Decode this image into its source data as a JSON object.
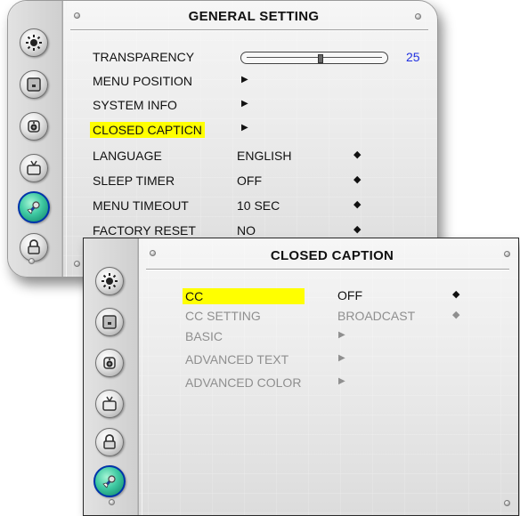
{
  "general_setting": {
    "title": "GENERAL SETTING",
    "transparency": {
      "label": "TRANSPARENCY",
      "value": "25",
      "level": 0.55
    },
    "items": [
      {
        "label": "MENU POSITION"
      },
      {
        "label": "SYSTEM INFO"
      },
      {
        "label": "CLOSED CAPTICN"
      }
    ],
    "settings": [
      {
        "label": "LANGUAGE",
        "value": "ENGLISH"
      },
      {
        "label": "SLEEP TIMER",
        "value": "OFF"
      },
      {
        "label": "MENU TIMEOUT",
        "value": "10 SEC"
      },
      {
        "label": "FACTORY RESET",
        "value": "NO"
      }
    ],
    "sidebar_icons": [
      "brightness-icon",
      "picture-icon",
      "audio-icon",
      "tv-icon",
      "settings-wrench-icon",
      "lock-icon"
    ]
  },
  "closed_caption": {
    "title": "CLOSED CAPTION",
    "cc": {
      "label": "CC",
      "value": "OFF"
    },
    "cc_setting": {
      "label": "CC SETTING",
      "value": "BROADCAST"
    },
    "submenus": [
      {
        "label": "BASIC"
      },
      {
        "label": "ADVANCED TEXT"
      },
      {
        "label": "ADVANCED COLOR"
      }
    ],
    "sidebar_icons": [
      "brightness-icon",
      "picture-icon",
      "audio-icon",
      "tv-icon",
      "lock-icon",
      "settings-wrench-icon"
    ]
  },
  "glyphs": {
    "arrow_right": "▶",
    "updown": "◆"
  },
  "colors": {
    "highlight": "#ffff00",
    "value_blue": "#2030e0",
    "active_icon_border": "#0033aa"
  }
}
